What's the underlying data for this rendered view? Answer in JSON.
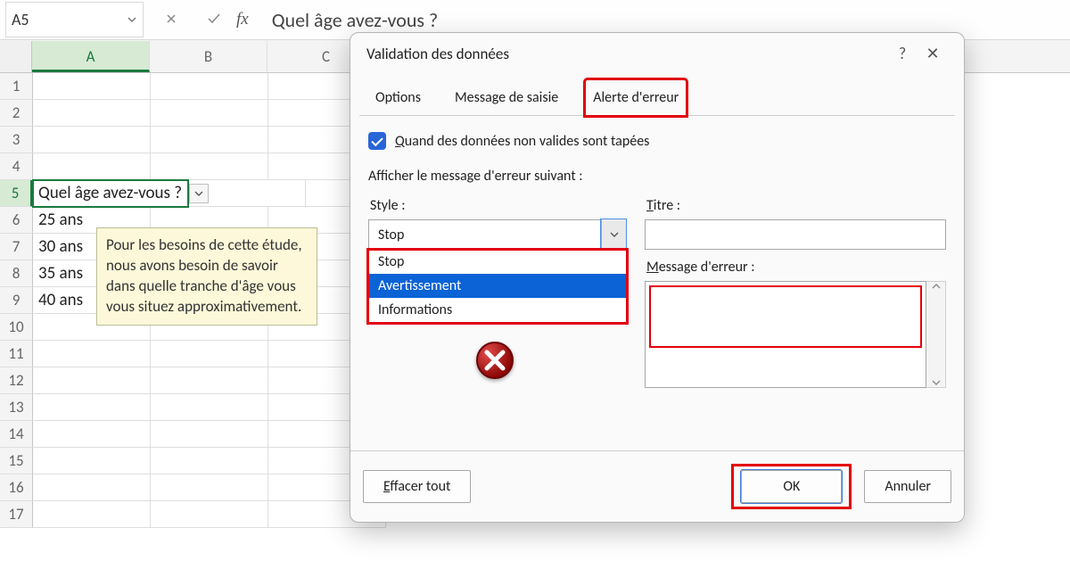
{
  "namebox": "A5",
  "fx_label": "fx",
  "formula_visible": "Quel âge avez-vous ?",
  "columns": [
    "A",
    "B",
    "C"
  ],
  "rows": [
    "1",
    "2",
    "3",
    "4",
    "5",
    "6",
    "7",
    "8",
    "9",
    "10",
    "11",
    "12",
    "13",
    "14",
    "15",
    "16",
    "17"
  ],
  "cells": {
    "A5": "Quel âge avez-vous ?",
    "A6": "25 ans",
    "A7": "30 ans",
    "A8": "35 ans",
    "A9": "40 ans"
  },
  "tooltip": "Pour les besoins de cette étude, nous avons besoin de savoir dans quelle tranche d'âge vous vous situez approximativement.",
  "dialog": {
    "title": "Validation des données",
    "tabs": {
      "options": "Options",
      "message": "Message de saisie",
      "error": "Alerte d'erreur"
    },
    "checkbox_prefix": "Q",
    "checkbox_rest": "uand des données non valides sont tapées",
    "section_label": "Afficher le message d'erreur suivant :",
    "style_label": "Style :",
    "title_label_u": "T",
    "title_label_rest": "itre :",
    "message_label_u": "M",
    "message_label_rest": "essage d'erreur :",
    "style_value": "Stop",
    "style_options": [
      "Stop",
      "Avertissement",
      "Informations"
    ],
    "clear": "Effacer tout",
    "ok": "OK",
    "cancel": "Annuler",
    "help": "?",
    "close": "✕"
  }
}
